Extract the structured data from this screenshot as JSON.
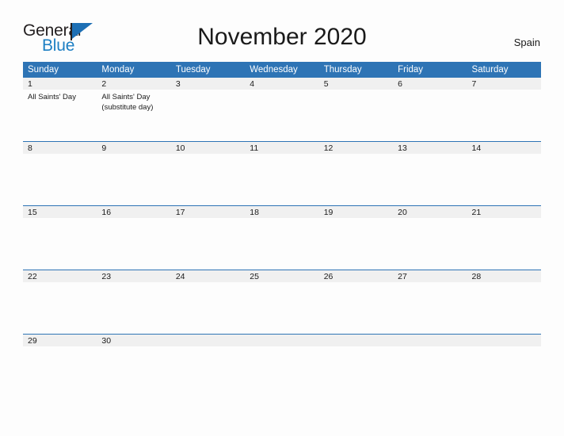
{
  "brand": {
    "name_part1": "General",
    "name_part2": "Blue",
    "flag_icon": "flag-icon"
  },
  "header": {
    "title": "November 2020",
    "country": "Spain"
  },
  "colors": {
    "header_blue": "#2e74b5",
    "rule_blue": "#2e74b5",
    "daynum_band": "#f0f0f0",
    "brand_blue": "#1d7fc3",
    "page_background": "#fdfdfd",
    "text": "#1a1a1a"
  },
  "calendar": {
    "weekday_headers": [
      "Sunday",
      "Monday",
      "Tuesday",
      "Wednesday",
      "Thursday",
      "Friday",
      "Saturday"
    ],
    "weeks": [
      [
        {
          "day": "1",
          "events": [
            "All Saints' Day"
          ]
        },
        {
          "day": "2",
          "events": [
            "All Saints' Day",
            "(substitute day)"
          ]
        },
        {
          "day": "3",
          "events": []
        },
        {
          "day": "4",
          "events": []
        },
        {
          "day": "5",
          "events": []
        },
        {
          "day": "6",
          "events": []
        },
        {
          "day": "7",
          "events": []
        }
      ],
      [
        {
          "day": "8",
          "events": []
        },
        {
          "day": "9",
          "events": []
        },
        {
          "day": "10",
          "events": []
        },
        {
          "day": "11",
          "events": []
        },
        {
          "day": "12",
          "events": []
        },
        {
          "day": "13",
          "events": []
        },
        {
          "day": "14",
          "events": []
        }
      ],
      [
        {
          "day": "15",
          "events": []
        },
        {
          "day": "16",
          "events": []
        },
        {
          "day": "17",
          "events": []
        },
        {
          "day": "18",
          "events": []
        },
        {
          "day": "19",
          "events": []
        },
        {
          "day": "20",
          "events": []
        },
        {
          "day": "21",
          "events": []
        }
      ],
      [
        {
          "day": "22",
          "events": []
        },
        {
          "day": "23",
          "events": []
        },
        {
          "day": "24",
          "events": []
        },
        {
          "day": "25",
          "events": []
        },
        {
          "day": "26",
          "events": []
        },
        {
          "day": "27",
          "events": []
        },
        {
          "day": "28",
          "events": []
        }
      ],
      [
        {
          "day": "29",
          "events": []
        },
        {
          "day": "30",
          "events": []
        },
        {
          "day": "",
          "events": []
        },
        {
          "day": "",
          "events": []
        },
        {
          "day": "",
          "events": []
        },
        {
          "day": "",
          "events": []
        },
        {
          "day": "",
          "events": []
        }
      ]
    ]
  }
}
